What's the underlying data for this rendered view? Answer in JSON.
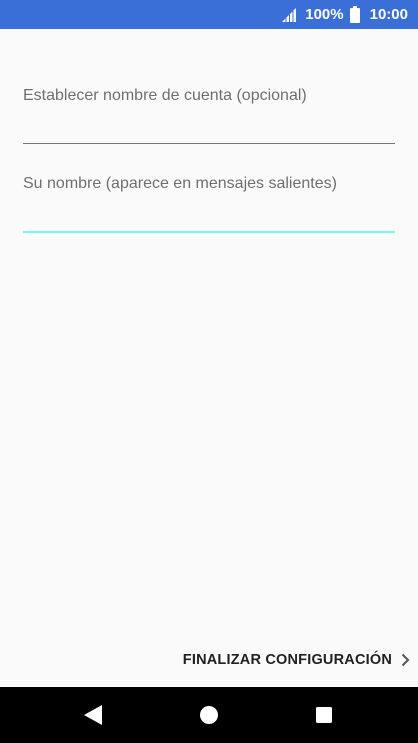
{
  "status_bar": {
    "battery_percent": "100%",
    "time": "10:00",
    "icons": [
      "signal-icon",
      "battery-icon"
    ]
  },
  "form": {
    "account_name": {
      "placeholder": "Establecer nombre de cuenta (opcional)",
      "value": ""
    },
    "your_name": {
      "placeholder": "Su nombre (aparece en mensajes salientes)",
      "value": "",
      "focused": true
    }
  },
  "actions": {
    "finish_label": "FINALIZAR CONFIGURACIÓN",
    "finish_icon": "chevron-right-icon"
  },
  "navigation": {
    "icons": [
      "back-icon",
      "home-icon",
      "recents-icon"
    ]
  },
  "colors": {
    "status_bar": "#3a6fd8",
    "focus_underline": "#7ef3f3",
    "background": "#fafafa"
  }
}
